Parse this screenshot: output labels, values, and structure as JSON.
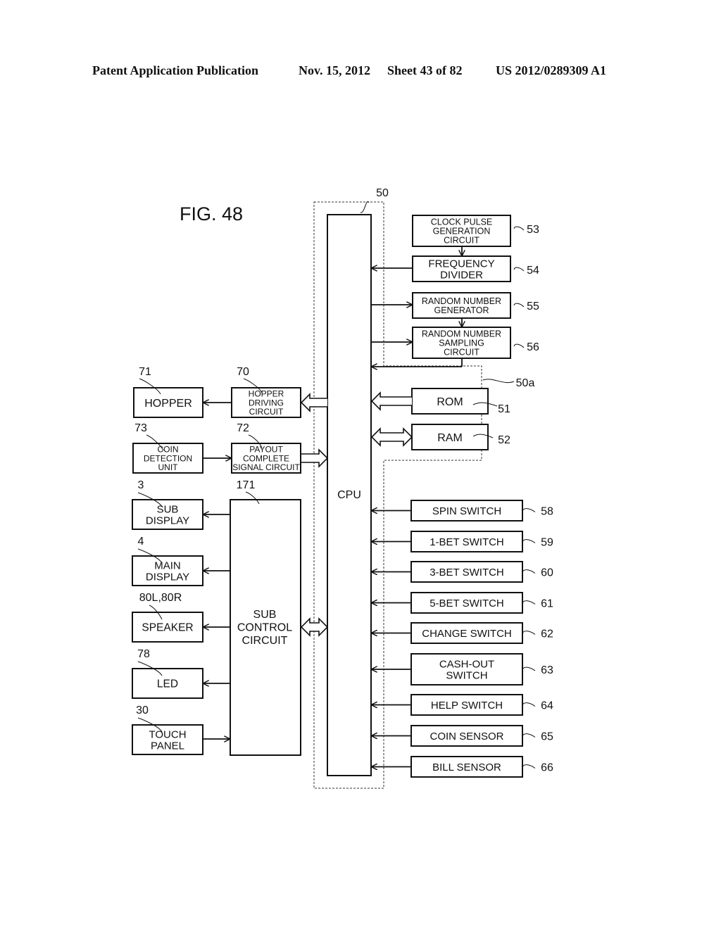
{
  "header": {
    "publication": "Patent Application Publication",
    "date": "Nov. 15, 2012",
    "sheet": "Sheet 43 of 82",
    "number": "US 2012/0289309 A1"
  },
  "figure": {
    "title": "FIG. 48",
    "controller_ref": "50",
    "memory_group_ref": "50a",
    "cpu": {
      "label": "CPU"
    },
    "sub_control": {
      "ref": "171",
      "lines": [
        "SUB",
        "CONTROL",
        "CIRCUIT"
      ]
    },
    "clock_blocks": [
      {
        "ref": "53",
        "lines": [
          "CLOCK PULSE",
          "GENERATION",
          "CIRCUIT"
        ]
      },
      {
        "ref": "54",
        "lines": [
          "FREQUENCY",
          "DIVIDER"
        ]
      },
      {
        "ref": "55",
        "lines": [
          "RANDOM NUMBER",
          "GENERATOR"
        ]
      },
      {
        "ref": "56",
        "lines": [
          "RANDOM NUMBER",
          "SAMPLING",
          "CIRCUIT"
        ]
      }
    ],
    "memory": [
      {
        "ref": "51",
        "label": "ROM"
      },
      {
        "ref": "52",
        "label": "RAM"
      }
    ],
    "payout": [
      {
        "ref": "71",
        "lines": [
          "HOPPER"
        ]
      },
      {
        "ref": "70",
        "lines": [
          "HOPPER",
          "DRIVING",
          "CIRCUIT"
        ]
      },
      {
        "ref": "73",
        "lines": [
          "COIN",
          "DETECTION",
          "UNIT"
        ]
      },
      {
        "ref": "72",
        "lines": [
          "PAYOUT",
          "COMPLETE",
          "SIGNAL CIRCUIT"
        ]
      }
    ],
    "peripherals": [
      {
        "ref": "3",
        "lines": [
          "SUB",
          "DISPLAY"
        ]
      },
      {
        "ref": "4",
        "lines": [
          "MAIN",
          "DISPLAY"
        ]
      },
      {
        "ref": "80L,80R",
        "lines": [
          "SPEAKER"
        ]
      },
      {
        "ref": "78",
        "lines": [
          "LED"
        ]
      },
      {
        "ref": "30",
        "lines": [
          "TOUCH",
          "PANEL"
        ]
      }
    ],
    "inputs": [
      {
        "ref": "58",
        "lines": [
          "SPIN SWITCH"
        ]
      },
      {
        "ref": "59",
        "lines": [
          "1-BET SWITCH"
        ]
      },
      {
        "ref": "60",
        "lines": [
          "3-BET SWITCH"
        ]
      },
      {
        "ref": "61",
        "lines": [
          "5-BET SWITCH"
        ]
      },
      {
        "ref": "62",
        "lines": [
          "CHANGE SWITCH"
        ]
      },
      {
        "ref": "63",
        "lines": [
          "CASH-OUT",
          "SWITCH"
        ]
      },
      {
        "ref": "64",
        "lines": [
          "HELP SWITCH"
        ]
      },
      {
        "ref": "65",
        "lines": [
          "COIN SENSOR"
        ]
      },
      {
        "ref": "66",
        "lines": [
          "BILL SENSOR"
        ]
      }
    ]
  }
}
